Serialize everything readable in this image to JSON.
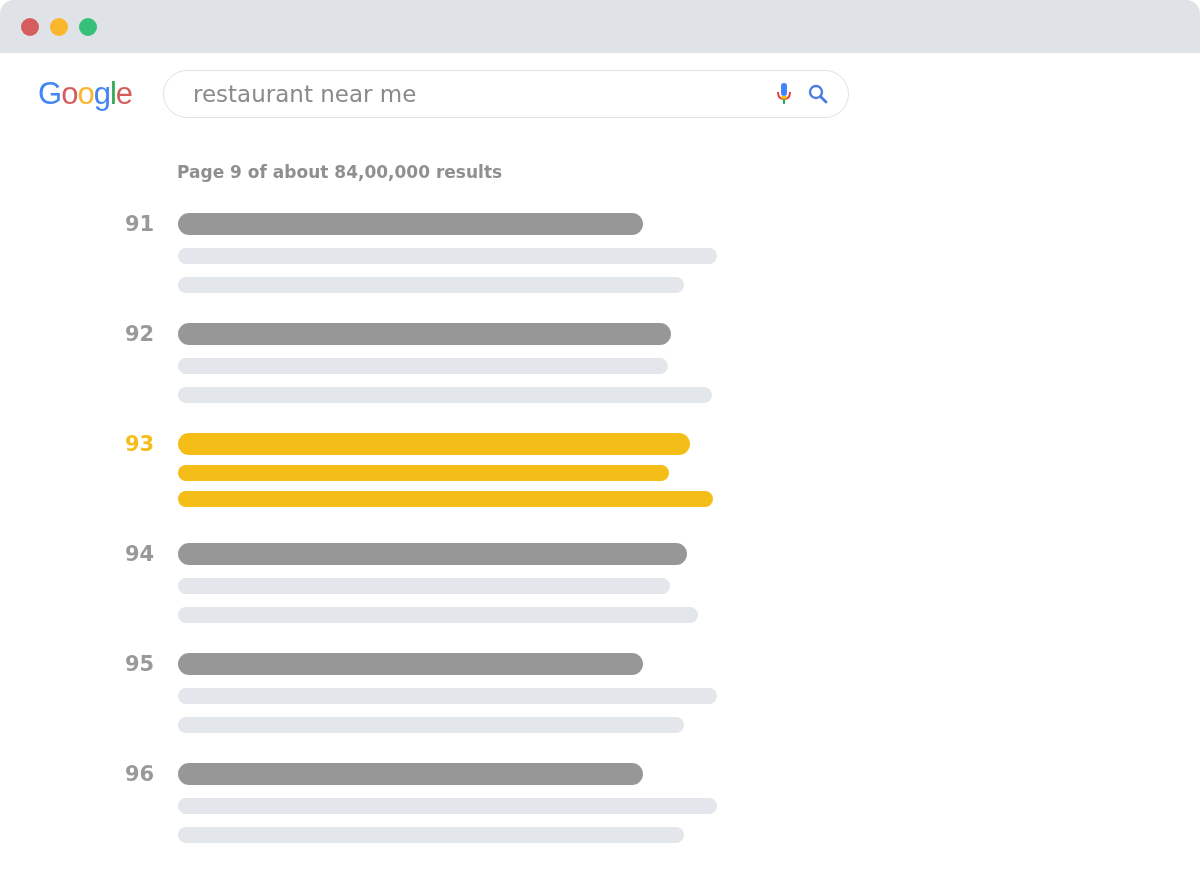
{
  "logo": "Google",
  "search": {
    "value": "restaurant near me"
  },
  "result_stats": "Page 9 of about 84,00,000 results",
  "results": [
    {
      "number": "91",
      "selected": false
    },
    {
      "number": "92",
      "selected": false
    },
    {
      "number": "93",
      "selected": true
    },
    {
      "number": "94",
      "selected": false
    },
    {
      "number": "95",
      "selected": false
    },
    {
      "number": "96",
      "selected": false
    }
  ]
}
